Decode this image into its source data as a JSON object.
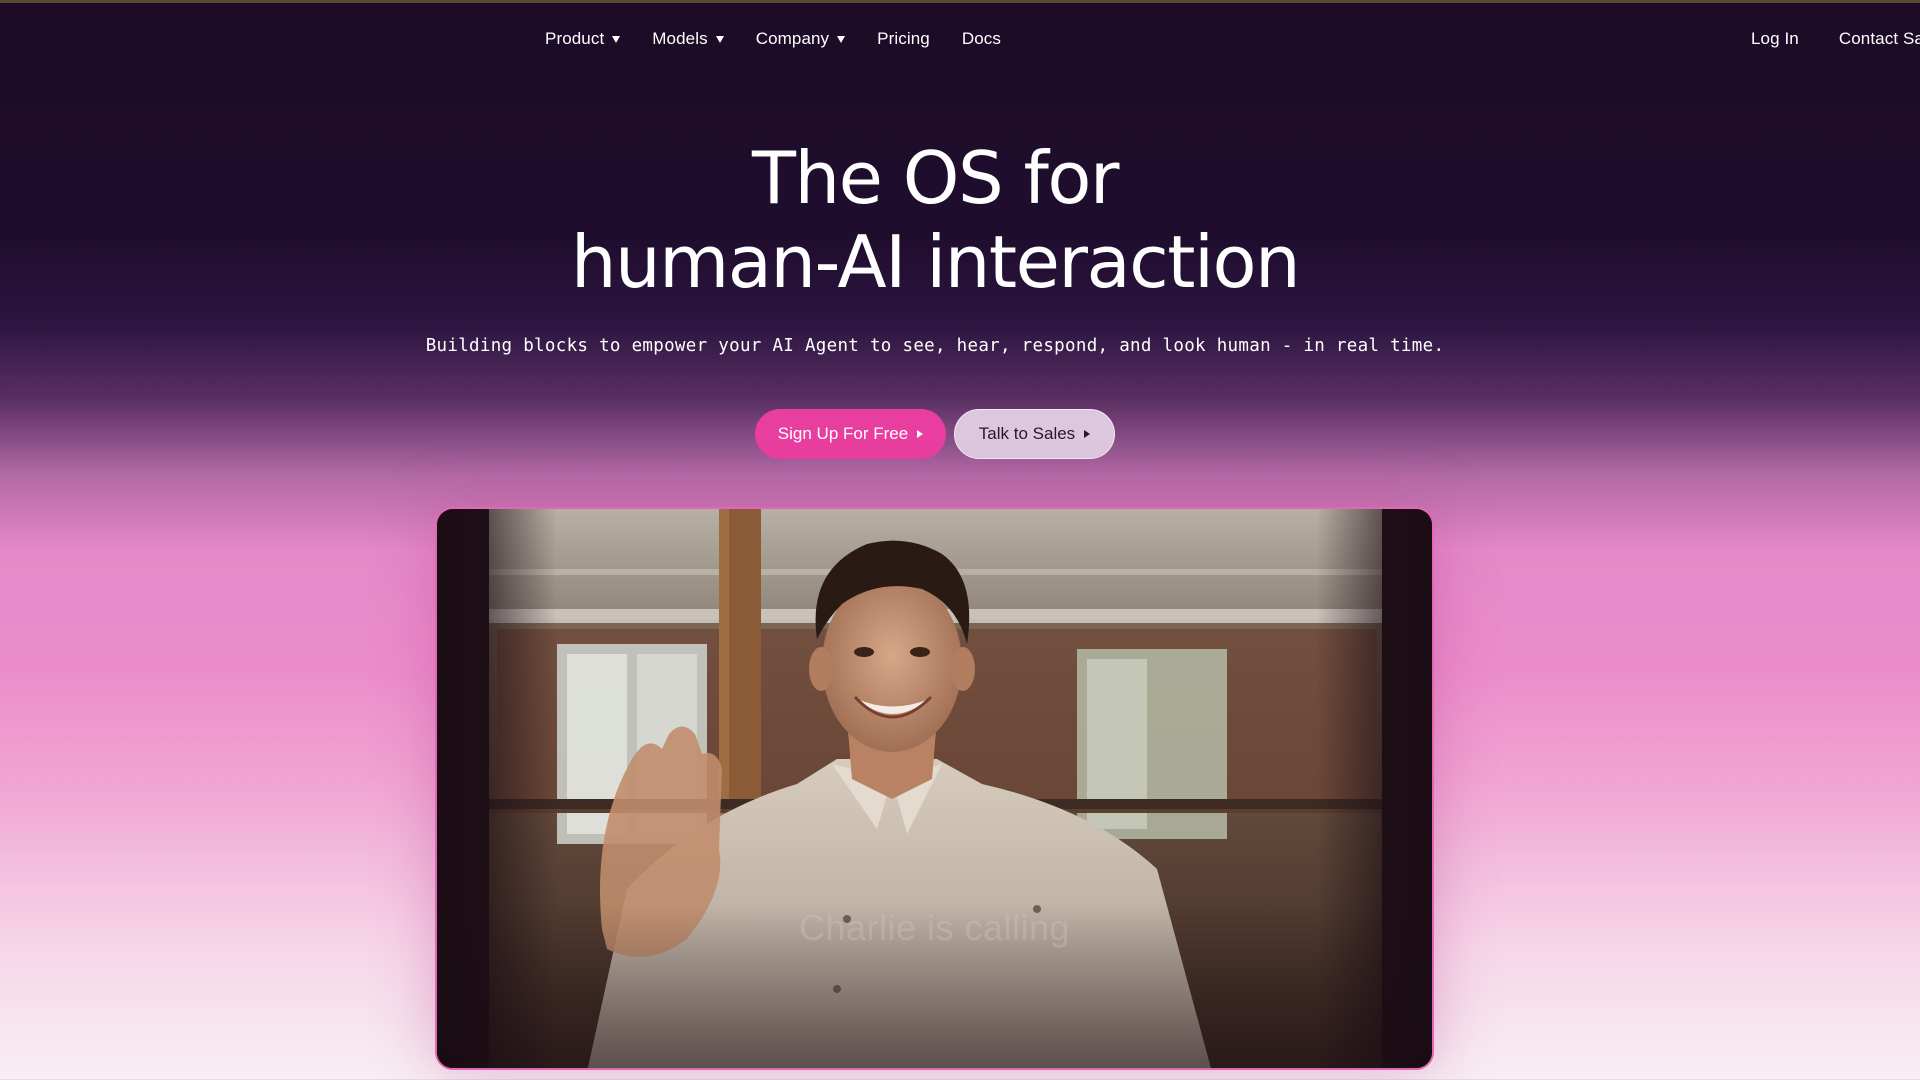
{
  "nav": {
    "items": [
      {
        "label": "Product",
        "dropdown": true
      },
      {
        "label": "Models",
        "dropdown": true
      },
      {
        "label": "Company",
        "dropdown": true
      },
      {
        "label": "Pricing",
        "dropdown": false
      },
      {
        "label": "Docs",
        "dropdown": false
      }
    ],
    "login": "Log In",
    "contact": "Contact Sales"
  },
  "hero": {
    "title_line1": "The OS for",
    "title_line2": "human-AI interaction",
    "subtitle": "Building blocks to empower your AI Agent to see, hear, respond, and look human - in real time."
  },
  "buttons": {
    "primary": "Sign Up For Free",
    "secondary": "Talk to Sales"
  },
  "video": {
    "caption": "Charlie is calling"
  },
  "colors": {
    "accent": "#e83e9f",
    "secondary_button": "#dcc7df",
    "card_border": "#e268b6"
  }
}
